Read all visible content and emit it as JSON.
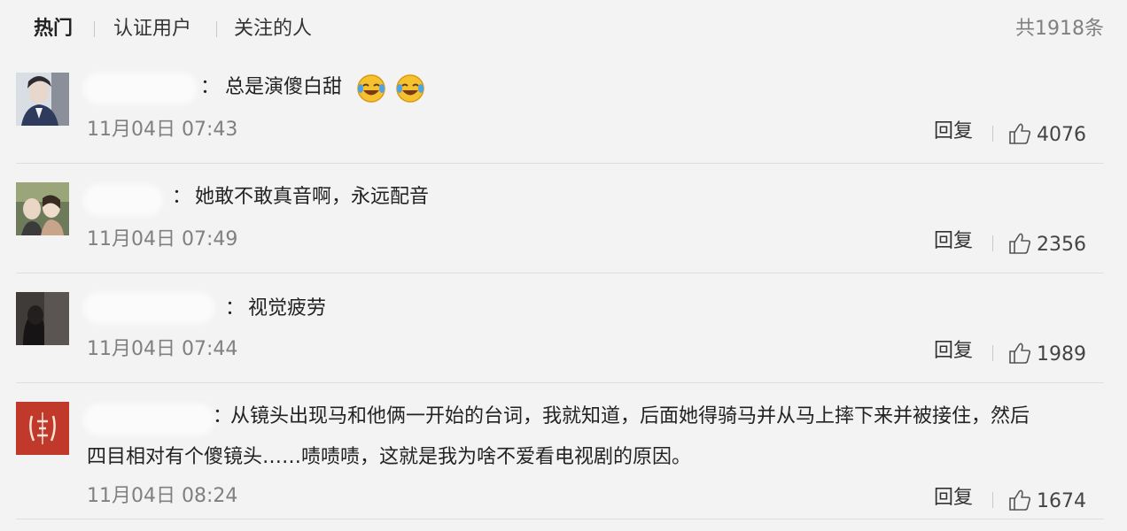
{
  "tabs": [
    {
      "label": "热门"
    },
    {
      "label": "认证用户"
    },
    {
      "label": "关注的人"
    }
  ],
  "total": "共1918条",
  "reply_label": "回复",
  "comments": [
    {
      "user_initial": "",
      "text": "总是演傻白甜",
      "time": "11月04日 07:43",
      "likes": "4076",
      "emojis": [
        "laugh-cry-emoji",
        "laugh-cry-emoji"
      ]
    },
    {
      "user_initial": "",
      "text": "她敢不敢真音啊，永远配音",
      "time": "11月04日 07:49",
      "likes": "2356"
    },
    {
      "user_initial": "",
      "text": "视觉疲劳",
      "time": "11月04日 07:44",
      "likes": "1989"
    },
    {
      "user_initial": "",
      "text": "从镜头出现马和他俩一开始的台词，我就知道，后面她得骑马并从马上摔下来并被接住，然后",
      "text2": "四目相对有个傻镜头……啧啧啧，这就是我为啥不爱看电视剧的原因。",
      "time": "11月04日 08:24",
      "likes": "1674"
    }
  ],
  "colors": {
    "background": "#f3f3f3",
    "muted_text": "#808080",
    "divider": "#dedede"
  }
}
